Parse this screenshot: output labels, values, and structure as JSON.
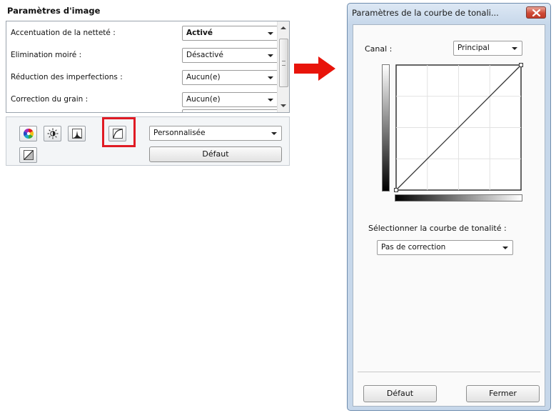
{
  "left_panel": {
    "title": "Paramètres d'image",
    "settings": [
      {
        "label": "Accentuation de la netteté :",
        "value": "Activé",
        "bold": true
      },
      {
        "label": "Elimination moiré :",
        "value": "Désactivé"
      },
      {
        "label": "Réduction des imperfections :",
        "value": "Aucun(e)"
      },
      {
        "label": "Correction du grain :",
        "value": "Aucun(e)"
      }
    ],
    "tools": {
      "buttons": [
        "color-wheel-icon",
        "brightness-icon",
        "histogram-icon",
        "tone-curve-icon",
        "final-review-icon"
      ],
      "preset_combo": "Personnalisée",
      "default_button": "Défaut"
    },
    "highlight_color": "#e01b24"
  },
  "arrow_color": "#e8140a",
  "dialog": {
    "title": "Paramètres de la courbe de tonali...",
    "canal_label": "Canal :",
    "canal_value": "Principal",
    "select_curve_label": "Sélectionner la courbe de tonalité :",
    "curve_value": "Pas de correction",
    "default_button": "Défaut",
    "close_button": "Fermer"
  }
}
